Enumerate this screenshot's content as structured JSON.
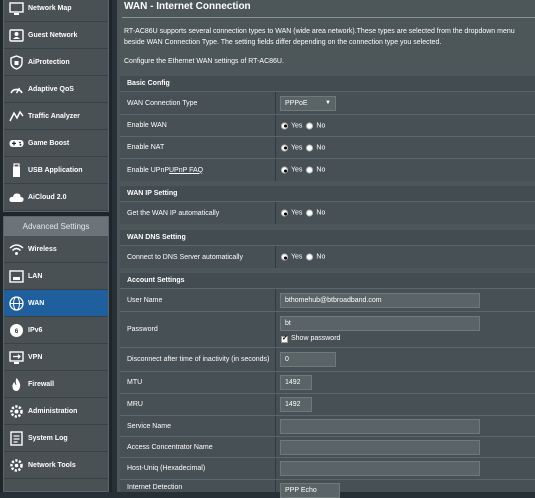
{
  "sidebar": {
    "general": [
      {
        "label": "Network Map",
        "icon": "network-map-icon"
      },
      {
        "label": "Guest Network",
        "icon": "guest-network-icon"
      },
      {
        "label": "AiProtection",
        "icon": "shield-icon"
      },
      {
        "label": "Adaptive QoS",
        "icon": "qos-icon"
      },
      {
        "label": "Traffic Analyzer",
        "icon": "traffic-analyzer-icon"
      },
      {
        "label": "Game Boost",
        "icon": "gamepad-icon"
      },
      {
        "label": "USB Application",
        "icon": "usb-icon"
      },
      {
        "label": "AiCloud 2.0",
        "icon": "cloud-icon"
      }
    ],
    "advanced_header": "Advanced Settings",
    "advanced": [
      {
        "label": "Wireless",
        "icon": "wireless-icon"
      },
      {
        "label": "LAN",
        "icon": "lan-icon"
      },
      {
        "label": "WAN",
        "icon": "globe-icon",
        "active": true
      },
      {
        "label": "IPv6",
        "icon": "ipv6-icon"
      },
      {
        "label": "VPN",
        "icon": "vpn-icon"
      },
      {
        "label": "Firewall",
        "icon": "firewall-icon"
      },
      {
        "label": "Administration",
        "icon": "administration-icon"
      },
      {
        "label": "System Log",
        "icon": "system-log-icon"
      },
      {
        "label": "Network Tools",
        "icon": "network-tools-icon"
      }
    ]
  },
  "main": {
    "title": "WAN - Internet Connection",
    "intro": "RT-AC86U supports several connection types to WAN (wide area network).These types are selected from the dropdown menu beside WAN Connection Type. The setting fields differ depending on the connection type you selected.",
    "config_note": "Configure the Ethernet WAN settings of RT-AC86U."
  },
  "basic_config": {
    "header": "Basic Config",
    "wan_type_label": "WAN Connection Type",
    "wan_type_value": "PPPoE",
    "enable_wan_label": "Enable WAN",
    "enable_nat_label": "Enable NAT",
    "enable_upnp_label": "Enable UPnP",
    "upnp_faq_link": "UPnP FAQ"
  },
  "wan_ip": {
    "header": "WAN IP Setting",
    "auto_label": "Get the WAN IP automatically"
  },
  "wan_dns": {
    "header": "WAN DNS Setting",
    "auto_label": "Connect to DNS Server automatically"
  },
  "radio": {
    "yes": "Yes",
    "no": "No"
  },
  "account": {
    "header": "Account Settings",
    "username_label": "User Name",
    "username_value": "bthomehub@btbroadband.com",
    "password_label": "Password",
    "password_value": "bt",
    "show_password_label": "Show password",
    "idle_label": "Disconnect after time of inactivity (in seconds)",
    "idle_value": "0",
    "mtu_label": "MTU",
    "mtu_value": "1492",
    "mru_label": "MRU",
    "mru_value": "1492",
    "service_name_label": "Service Name",
    "service_name_value": "",
    "ac_name_label": "Access Concentrator Name",
    "ac_name_value": "",
    "host_uniq_label": "Host-Uniq (Hexadecimal)",
    "host_uniq_value": "",
    "detection_label": "Internet Detection",
    "detection_value": "PPP Echo"
  }
}
